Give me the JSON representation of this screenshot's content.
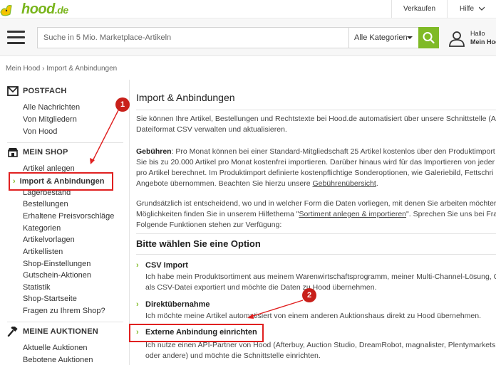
{
  "topbar": {
    "logo_text": "hood",
    "logo_tld": ".de",
    "links": [
      "Verkaufen",
      "Hilfe"
    ]
  },
  "header": {
    "search_placeholder": "Suche in 5 Mio. Marketplace-Artikeln",
    "category": "Alle Kategorien",
    "user_greeting": "Hallo",
    "user_account": "Mein Hood"
  },
  "breadcrumb": "Mein Hood › Import & Anbindungen",
  "sidebar": {
    "postfach": {
      "title": "POSTFACH",
      "items": [
        "Alle Nachrichten",
        "Von Mitgliedern",
        "Von Hood"
      ]
    },
    "shop": {
      "title": "MEIN SHOP",
      "items": [
        "Artikel anlegen",
        "Import & Anbindungen",
        "Lagerbestand",
        "Bestellungen",
        "Erhaltene Preisvorschläge",
        "Kategorien",
        "Artikelvorlagen",
        "Artikellisten",
        "Shop-Einstellungen",
        "Gutschein-Aktionen",
        "Statistik",
        "Shop-Startseite",
        "Fragen zu Ihrem Shop?"
      ]
    },
    "auktionen": {
      "title": "MEINE AUKTIONEN",
      "items": [
        "Aktuelle Auktionen",
        "Bebotene Auktionen"
      ]
    }
  },
  "main": {
    "title": "Import & Anbindungen",
    "intro": [
      "Sie können Ihre Artikel, Bestellungen und Rechtstexte bei Hood.de automatisiert über unsere Schnittstelle (A",
      "Dateiformat CSV verwalten und aktualisieren."
    ],
    "fees_label": "Gebühren",
    "fees": [
      ": Pro Monat können bei einer Standard-Mitgliedschaft 25 Artikel kostenlos über den Produktimport",
      "Sie bis zu 20.000 Artikel pro Monat kostenfrei importieren. Darüber hinaus wird für das Importieren von jeder",
      "pro Artikel berechnet. Im Produktimport definierte kostenpflichtige Sonderoptionen, wie Galeriebild, Fettschri",
      "Angebote übernommen. Beachten Sie hierzu unsere "
    ],
    "fees_link": "Gebührenübersicht",
    "fees_end": ".",
    "info": [
      "Grundsätzlich ist entscheidend, wo und in welcher Form die Daten vorliegen, mit denen Sie arbeiten möchter",
      "Möglichkeiten finden Sie in unserem Hilfethema \"",
      "Folgende Funktionen stehen zur Verfügung:"
    ],
    "info_link": "Sortiment anlegen & importieren",
    "info_after_link": "\". Sprechen Sie uns bei Fra",
    "options_title": "Bitte wählen Sie eine Option",
    "options": [
      {
        "label": "CSV Import",
        "desc": [
          "Ich habe mein Produktsortiment aus meinem Warenwirtschaftsprogramm, meiner Multi-Channel-Lösung, C",
          "als CSV-Datei exportiert und möchte die Daten zu Hood übernehmen."
        ]
      },
      {
        "label": "Direktübernahme",
        "desc": [
          "Ich möchte meine Artikel automatisiert von einem anderen Auktionshaus direkt zu Hood übernehmen."
        ]
      },
      {
        "label": "Externe Anbindung einrichten",
        "desc": [
          "Ich nutze einen API-Partner von Hood (Afterbuy, Auction Studio, DreamRobot, magnalister, Plentymarkets",
          "oder "
        ],
        "desc_link": "andere",
        "desc_end": ") und möchte die Schnittstelle einrichten."
      }
    ]
  },
  "annotations": [
    "1",
    "2"
  ],
  "colors": {
    "brand": "#7fba26",
    "annotation": "#e02020"
  }
}
